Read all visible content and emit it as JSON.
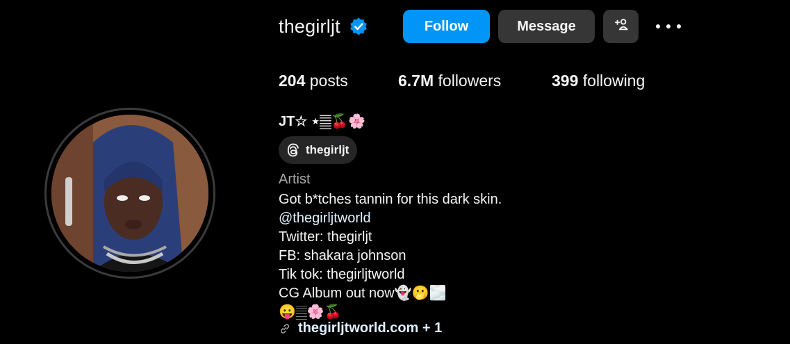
{
  "profile": {
    "username": "thegirljt",
    "verified": true,
    "follow_label": "Follow",
    "message_label": "Message",
    "stats": {
      "posts_count": "204",
      "posts_label": "posts",
      "followers_count": "6.7M",
      "followers_label": "followers",
      "following_count": "399",
      "following_label": "following"
    },
    "full_name": "JT☆ ⋆𝄛🍒🌸",
    "threads_handle": "thegirljt",
    "category": "Artist",
    "bio_lines": [
      "Got b*tches tannin for this dark skin.",
      "@thegirljtworld",
      "Twitter: thegirljt",
      "FB: shakara johnson",
      "Tik tok: thegirljtworld",
      "CG Album out now👻🫢🌫️",
      "😛𝄛🌸🍒"
    ],
    "link_text": "thegirljtworld.com + 1"
  },
  "icons": {
    "verified": "verified-badge-icon",
    "suggest": "add-person-icon",
    "more": "more-options-icon",
    "threads": "threads-icon",
    "link": "link-icon"
  },
  "colors": {
    "background": "#000000",
    "accent": "#0095f6",
    "button_secondary": "#363636",
    "link": "#e0f1ff",
    "muted": "#a8a8a8"
  }
}
